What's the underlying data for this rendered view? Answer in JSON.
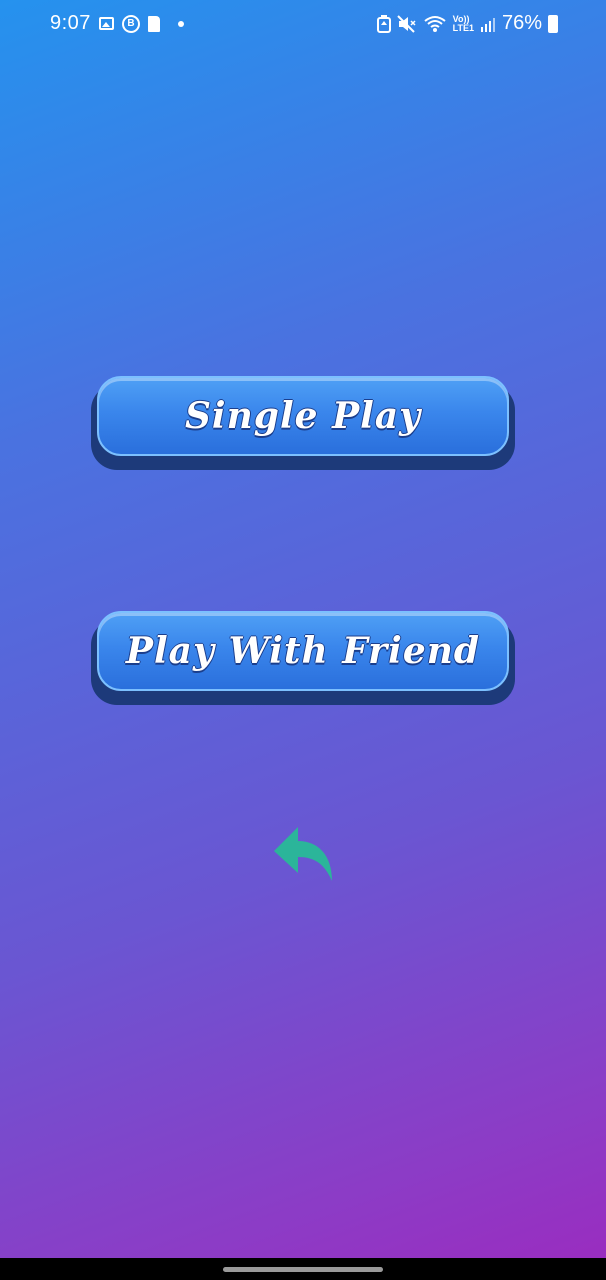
{
  "status_bar": {
    "time": "9:07",
    "left_icons": [
      "image-icon",
      "business-icon",
      "sd-card-icon",
      "dot-icon"
    ],
    "right_icons": [
      "battery-saver-icon",
      "mute-icon",
      "wifi-icon",
      "volte-icon",
      "signal-icon"
    ],
    "volte_label_top": "Vo))",
    "volte_label_bottom": "LTE1",
    "battery_percent": "76%",
    "b_letter": "B"
  },
  "menu": {
    "single_play_label": "Single Play",
    "play_with_friend_label": "Play With Friend"
  },
  "back": {
    "icon": "back-arrow-icon",
    "color": "#2bb59a"
  },
  "colors": {
    "background_top": "#2592ee",
    "background_bottom": "#9b2bbf",
    "button_face": "#3a86ec",
    "button_shadow": "#1d3a7a"
  }
}
